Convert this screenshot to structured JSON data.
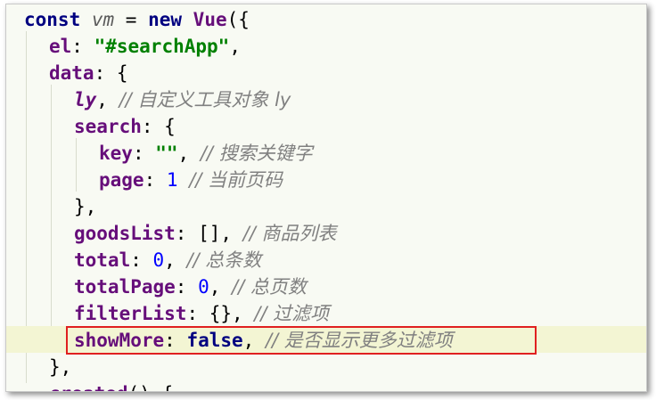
{
  "code": {
    "lines": [
      {
        "indent": 0,
        "tokens": [
          {
            "t": "const ",
            "c": "kw"
          },
          {
            "t": "vm",
            "c": "var"
          },
          {
            "t": " = ",
            "c": "plain"
          },
          {
            "t": "new ",
            "c": "kw"
          },
          {
            "t": "Vue",
            "c": "prop"
          },
          {
            "t": "({",
            "c": "plain"
          }
        ]
      },
      {
        "indent": 1,
        "tokens": [
          {
            "t": "el",
            "c": "prop"
          },
          {
            "t": ": ",
            "c": "plain"
          },
          {
            "t": "\"#searchApp\"",
            "c": "str"
          },
          {
            "t": ",",
            "c": "plain"
          }
        ]
      },
      {
        "indent": 1,
        "tokens": [
          {
            "t": "data",
            "c": "prop"
          },
          {
            "t": ": {",
            "c": "plain"
          }
        ]
      },
      {
        "indent": 2,
        "tokens": [
          {
            "t": "ly",
            "c": "prop-i"
          },
          {
            "t": ", ",
            "c": "plain"
          },
          {
            "t": "// 自定义工具对象 ly",
            "c": "cmt"
          }
        ]
      },
      {
        "indent": 2,
        "tokens": [
          {
            "t": "search",
            "c": "prop"
          },
          {
            "t": ": {",
            "c": "plain"
          }
        ]
      },
      {
        "indent": 3,
        "tokens": [
          {
            "t": "key",
            "c": "prop"
          },
          {
            "t": ": ",
            "c": "plain"
          },
          {
            "t": "\"\"",
            "c": "str"
          },
          {
            "t": ", ",
            "c": "plain"
          },
          {
            "t": "// 搜索关键字",
            "c": "cmt"
          }
        ]
      },
      {
        "indent": 3,
        "tokens": [
          {
            "t": "page",
            "c": "prop"
          },
          {
            "t": ": ",
            "c": "plain"
          },
          {
            "t": "1",
            "c": "num"
          },
          {
            "t": " ",
            "c": "plain"
          },
          {
            "t": "// 当前页码",
            "c": "cmt"
          }
        ]
      },
      {
        "indent": 2,
        "tokens": [
          {
            "t": "},",
            "c": "plain"
          }
        ]
      },
      {
        "indent": 2,
        "tokens": [
          {
            "t": "goodsList",
            "c": "prop"
          },
          {
            "t": ": [], ",
            "c": "plain"
          },
          {
            "t": "// 商品列表",
            "c": "cmt"
          }
        ]
      },
      {
        "indent": 2,
        "tokens": [
          {
            "t": "total",
            "c": "prop"
          },
          {
            "t": ": ",
            "c": "plain"
          },
          {
            "t": "0",
            "c": "num"
          },
          {
            "t": ", ",
            "c": "plain"
          },
          {
            "t": "// 总条数",
            "c": "cmt"
          }
        ]
      },
      {
        "indent": 2,
        "tokens": [
          {
            "t": "totalPage",
            "c": "prop"
          },
          {
            "t": ": ",
            "c": "plain"
          },
          {
            "t": "0",
            "c": "num"
          },
          {
            "t": ", ",
            "c": "plain"
          },
          {
            "t": "// 总页数",
            "c": "cmt"
          }
        ]
      },
      {
        "indent": 2,
        "tokens": [
          {
            "t": "filterList",
            "c": "prop"
          },
          {
            "t": ": {}, ",
            "c": "plain"
          },
          {
            "t": "// 过滤项",
            "c": "cmt"
          }
        ]
      },
      {
        "indent": 2,
        "tokens": [
          {
            "t": "showMore",
            "c": "prop"
          },
          {
            "t": ": ",
            "c": "plain"
          },
          {
            "t": "false",
            "c": "kw"
          },
          {
            "t": ", ",
            "c": "plain"
          },
          {
            "t": "// 是否显示更多过滤项",
            "c": "cmt"
          }
        ]
      },
      {
        "indent": 1,
        "tokens": [
          {
            "t": "},",
            "c": "plain"
          }
        ]
      },
      {
        "indent": 1,
        "tokens": [
          {
            "t": "created",
            "c": "prop"
          },
          {
            "t": "() {",
            "c": "plain"
          }
        ]
      }
    ],
    "highlighted_line": 12
  },
  "colors": {
    "keyword": "#000080",
    "property": "#660e7a",
    "string": "#008000",
    "number": "#0000ff",
    "comment": "#808080",
    "highlight_box": "#e02020",
    "current_line": "#f3f5d3",
    "background": "#f8faf3"
  }
}
